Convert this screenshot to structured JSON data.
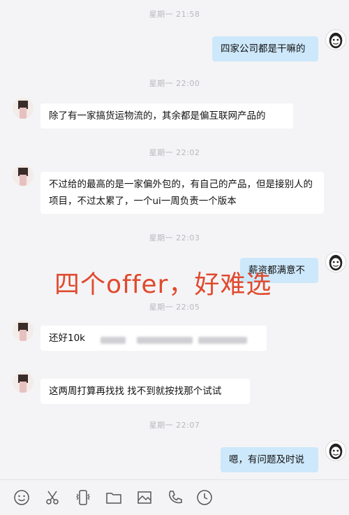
{
  "messages": [
    {
      "timestamp": "星期一 21:58"
    },
    {
      "text": "四家公司都是干嘛的"
    },
    {
      "timestamp": "星期一 22:00"
    },
    {
      "text": "除了有一家搞货运物流的，其余都是偏互联网产品的"
    },
    {
      "timestamp": "星期一 22:02"
    },
    {
      "text": "不过给的最高的是一家偏外包的，有自己的产品，但是接别人的项目，不过太累了，一个ui一周负责一个版本"
    },
    {
      "timestamp": "星期一 22:03"
    },
    {
      "text": "薪资都满意不"
    },
    {
      "timestamp": "星期一 22:05"
    },
    {
      "text": "还好10k"
    },
    {
      "text": "这两周打算再找找  找不到就按找那个试试"
    },
    {
      "timestamp": "星期一 22:07"
    },
    {
      "text": "嗯，有问题及时说"
    }
  ],
  "overlay_text": "四个offer，好难选",
  "toolbar": [
    "emoji-icon",
    "scissors-icon",
    "phone-vibrate-icon",
    "folder-icon",
    "image-icon",
    "phone-call-icon",
    "history-clock-icon"
  ],
  "colors": {
    "incoming_bubble": "#ffffff",
    "outgoing_bubble": "#cde8fb",
    "overlay_text": "#e04a2e",
    "background": "#f4f4f6"
  }
}
